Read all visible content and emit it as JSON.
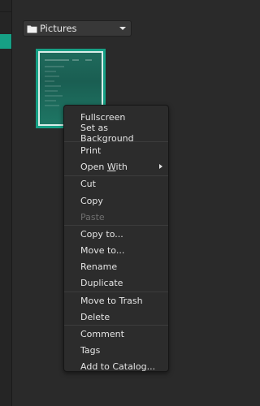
{
  "folder_selector": {
    "label": "Pictures",
    "icon": "folder-icon"
  },
  "colors": {
    "accent": "#16a085"
  },
  "context_menu": {
    "items": [
      {
        "label": "Fullscreen",
        "enabled": true
      },
      {
        "label": "Set as Background",
        "enabled": true
      },
      {
        "label": "Print",
        "enabled": true
      },
      {
        "label_prefix": "Open ",
        "label_underlined": "W",
        "label_suffix": "ith",
        "enabled": true,
        "has_submenu": true
      },
      {
        "label": "Cut",
        "enabled": true
      },
      {
        "label": "Copy",
        "enabled": true
      },
      {
        "label": "Paste",
        "enabled": false
      },
      {
        "label": "Copy to...",
        "enabled": true
      },
      {
        "label": "Move to...",
        "enabled": true
      },
      {
        "label": "Rename",
        "enabled": true
      },
      {
        "label": "Duplicate",
        "enabled": true
      },
      {
        "label": "Move to Trash",
        "enabled": true
      },
      {
        "label": "Delete",
        "enabled": true
      },
      {
        "label": "Comment",
        "enabled": true
      },
      {
        "label": "Tags",
        "enabled": true
      },
      {
        "label": "Add to Catalog...",
        "enabled": true
      }
    ]
  }
}
